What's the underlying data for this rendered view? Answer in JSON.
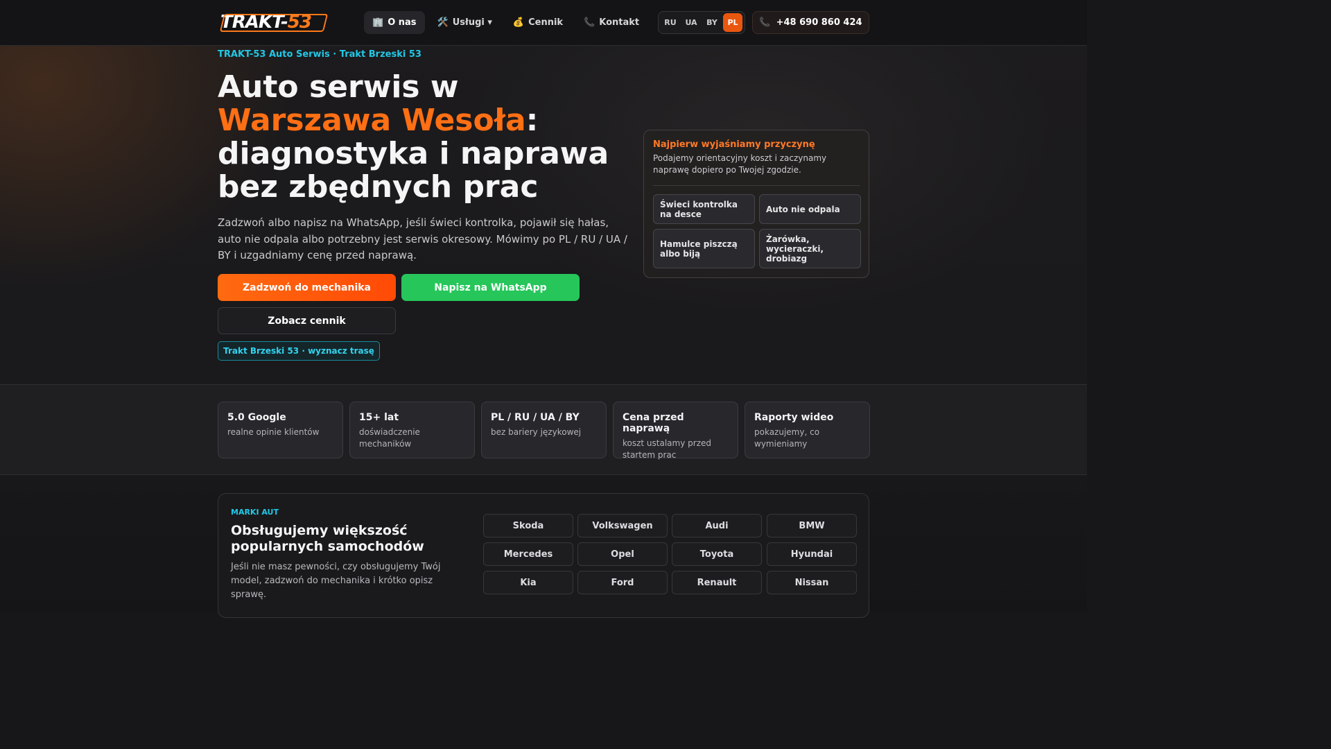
{
  "nav": {
    "logo_part1": "TRAKT-",
    "logo_part2": "53",
    "menu": [
      {
        "icon": "🏢",
        "label": "O nas"
      },
      {
        "icon": "🛠️",
        "label": "Usługi ▾"
      },
      {
        "icon": "💰",
        "label": "Cennik"
      },
      {
        "icon": "📞",
        "label": "Kontakt"
      }
    ],
    "languages": [
      "RU",
      "UA",
      "BY",
      "PL"
    ],
    "active_language": "PL",
    "phone_icon": "📞",
    "phone": "+48 690 860 424"
  },
  "hero": {
    "kicker": "TRAKT-53 Auto Serwis · Trakt Brzeski 53",
    "title_line1": "Auto serwis w",
    "title_accent": "Warszawa Wesoła",
    "title_colon": ":",
    "title_line3": "diagnostyka i naprawa",
    "title_line4": "bez zbędnych prac",
    "lead": "Zadzwoń albo napisz na WhatsApp, jeśli świeci kontrolka, pojawił się hałas, auto nie odpala albo potrzebny jest serwis okresowy. Mówimy po PL / RU / UA / BY i uzgadniamy cenę przed naprawą.",
    "btn_call": "Zadzwoń do mechanika",
    "btn_whatsapp": "Napisz na WhatsApp",
    "btn_prices": "Zobacz cennik",
    "route": "Trakt Brzeski 53 · wyznacz trasę"
  },
  "card": {
    "title": "Najpierw wyjaśniamy przyczynę",
    "text": "Podajemy orientacyjny koszt i zaczynamy naprawę dopiero po Twojej zgodzie.",
    "tiles": [
      "Świeci kontrolka na desce",
      "Auto nie odpala",
      "Hamulce piszczą albo biją",
      "Żarówka, wycieraczki, drobiazg"
    ]
  },
  "stats": [
    {
      "title": "5.0 Google",
      "sub": "realne opinie klientów"
    },
    {
      "title": "15+ lat",
      "sub": "doświadczenie mechaników"
    },
    {
      "title": "PL / RU / UA / BY",
      "sub": "bez bariery językowej"
    },
    {
      "title": "Cena przed naprawą",
      "sub": "koszt ustalamy przed startem prac"
    },
    {
      "title": "Raporty wideo",
      "sub": "pokazujemy, co wymieniamy"
    }
  ],
  "brands": {
    "kicker": "MARKI AUT",
    "title": "Obsługujemy większość popularnych samochodów",
    "text": "Jeśli nie masz pewności, czy obsługujemy Twój model, zadzwoń do mechanika i krótko opisz sprawę.",
    "items": [
      "Skoda",
      "Volkswagen",
      "Audi",
      "BMW",
      "Mercedes",
      "Opel",
      "Toyota",
      "Hyundai",
      "Kia",
      "Ford",
      "Renault",
      "Nissan"
    ]
  },
  "colors": {
    "accent_orange": "#ff6f14",
    "accent_cyan": "#21c8e6",
    "whatsapp_green": "#26c65a"
  }
}
